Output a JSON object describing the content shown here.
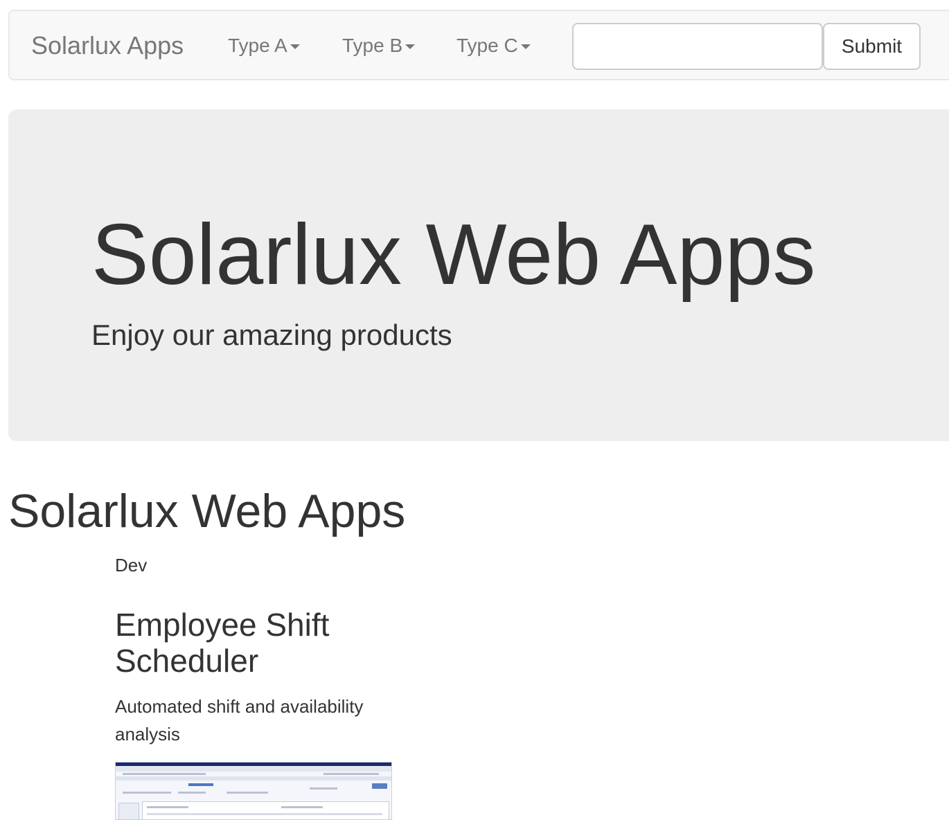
{
  "navbar": {
    "brand": "Solarlux Apps",
    "menus": [
      {
        "label": "Type A"
      },
      {
        "label": "Type B"
      },
      {
        "label": "Type C"
      }
    ],
    "search": {
      "value": "",
      "placeholder": ""
    },
    "submit_label": "Submit"
  },
  "jumbotron": {
    "title": "Solarlux Web Apps",
    "subtitle": "Enjoy our amazing products"
  },
  "main": {
    "title": "Solarlux Web Apps",
    "apps": [
      {
        "category": "Dev",
        "title": "Employee Shift Scheduler",
        "description": "Automated shift and availability analysis",
        "thumbnail_icon": "app-screenshot"
      }
    ]
  },
  "colors": {
    "navbar_bg": "#f8f8f8",
    "jumbotron_bg": "#eeeeee",
    "text": "#333333",
    "muted_text": "#777777"
  }
}
